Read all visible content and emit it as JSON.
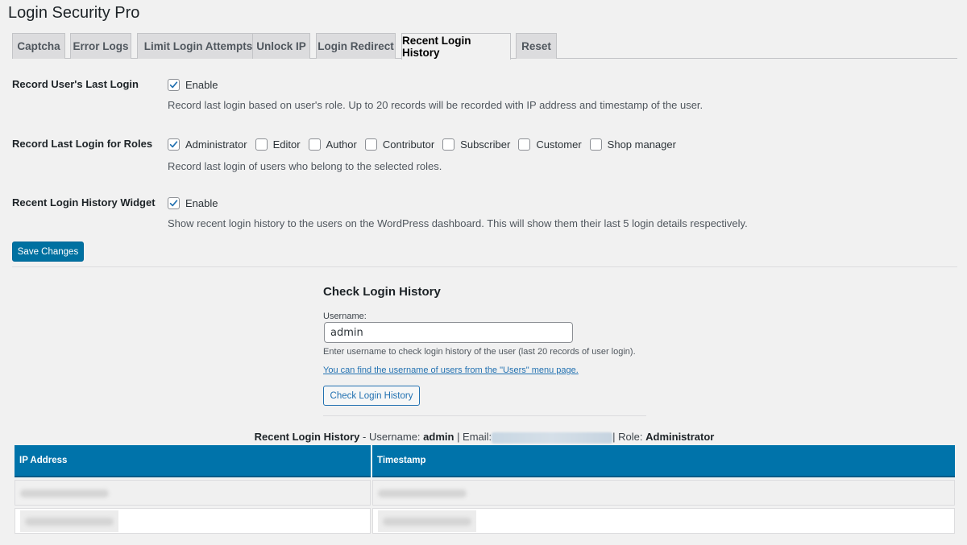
{
  "page": {
    "title": "Login Security Pro"
  },
  "tabs": [
    {
      "label": "Captcha",
      "active": false
    },
    {
      "label": "Error Logs",
      "active": false
    },
    {
      "label": "Limit Login Attempts",
      "active": false
    },
    {
      "label": "Unlock IP",
      "active": false
    },
    {
      "label": "Login Redirect",
      "active": false
    },
    {
      "label": "Recent Login History",
      "active": true
    },
    {
      "label": "Reset",
      "active": false
    }
  ],
  "settings": {
    "last_login": {
      "label": "Record User's Last Login",
      "checkbox_label": "Enable",
      "checked": true,
      "description": "Record last login based on user's role. Up to 20 records will be recorded with IP address and timestamp of the user."
    },
    "roles": {
      "label": "Record Last Login for Roles",
      "options": [
        {
          "label": "Administrator",
          "checked": true
        },
        {
          "label": "Editor",
          "checked": false
        },
        {
          "label": "Author",
          "checked": false
        },
        {
          "label": "Contributor",
          "checked": false
        },
        {
          "label": "Subscriber",
          "checked": false
        },
        {
          "label": "Customer",
          "checked": false
        },
        {
          "label": "Shop manager",
          "checked": false
        }
      ],
      "description": "Record last login of users who belong to the selected roles."
    },
    "widget": {
      "label": "Recent Login History Widget",
      "checkbox_label": "Enable",
      "checked": true,
      "description": "Show recent login history to the users on the WordPress dashboard. This will show them their last 5 login details respectively."
    },
    "save_label": "Save Changes"
  },
  "check_history": {
    "title": "Check Login History",
    "username_label": "Username:",
    "username_value": "admin",
    "hint": "Enter username to check login history of the user (last 20 records of user login).",
    "link": "You can find the username of users from the \"Users\" menu page.",
    "button_label": "Check Login History"
  },
  "results": {
    "heading": "Recent Login History",
    "sep": " - ",
    "username_label": "Username: ",
    "username": "admin",
    "email_label": " | Email:",
    "role_label": "| Role: ",
    "role": "Administrator",
    "columns": [
      "IP Address",
      "Timestamp"
    ],
    "rows": [
      {
        "ip": "(redacted)",
        "timestamp": "(redacted)"
      },
      {
        "ip": "(redacted)",
        "timestamp": "(redacted)"
      }
    ]
  },
  "colors": {
    "primary": "#0071a1",
    "table_header": "#0073aa",
    "link": "#2271b1",
    "background": "#f1f1f1"
  }
}
